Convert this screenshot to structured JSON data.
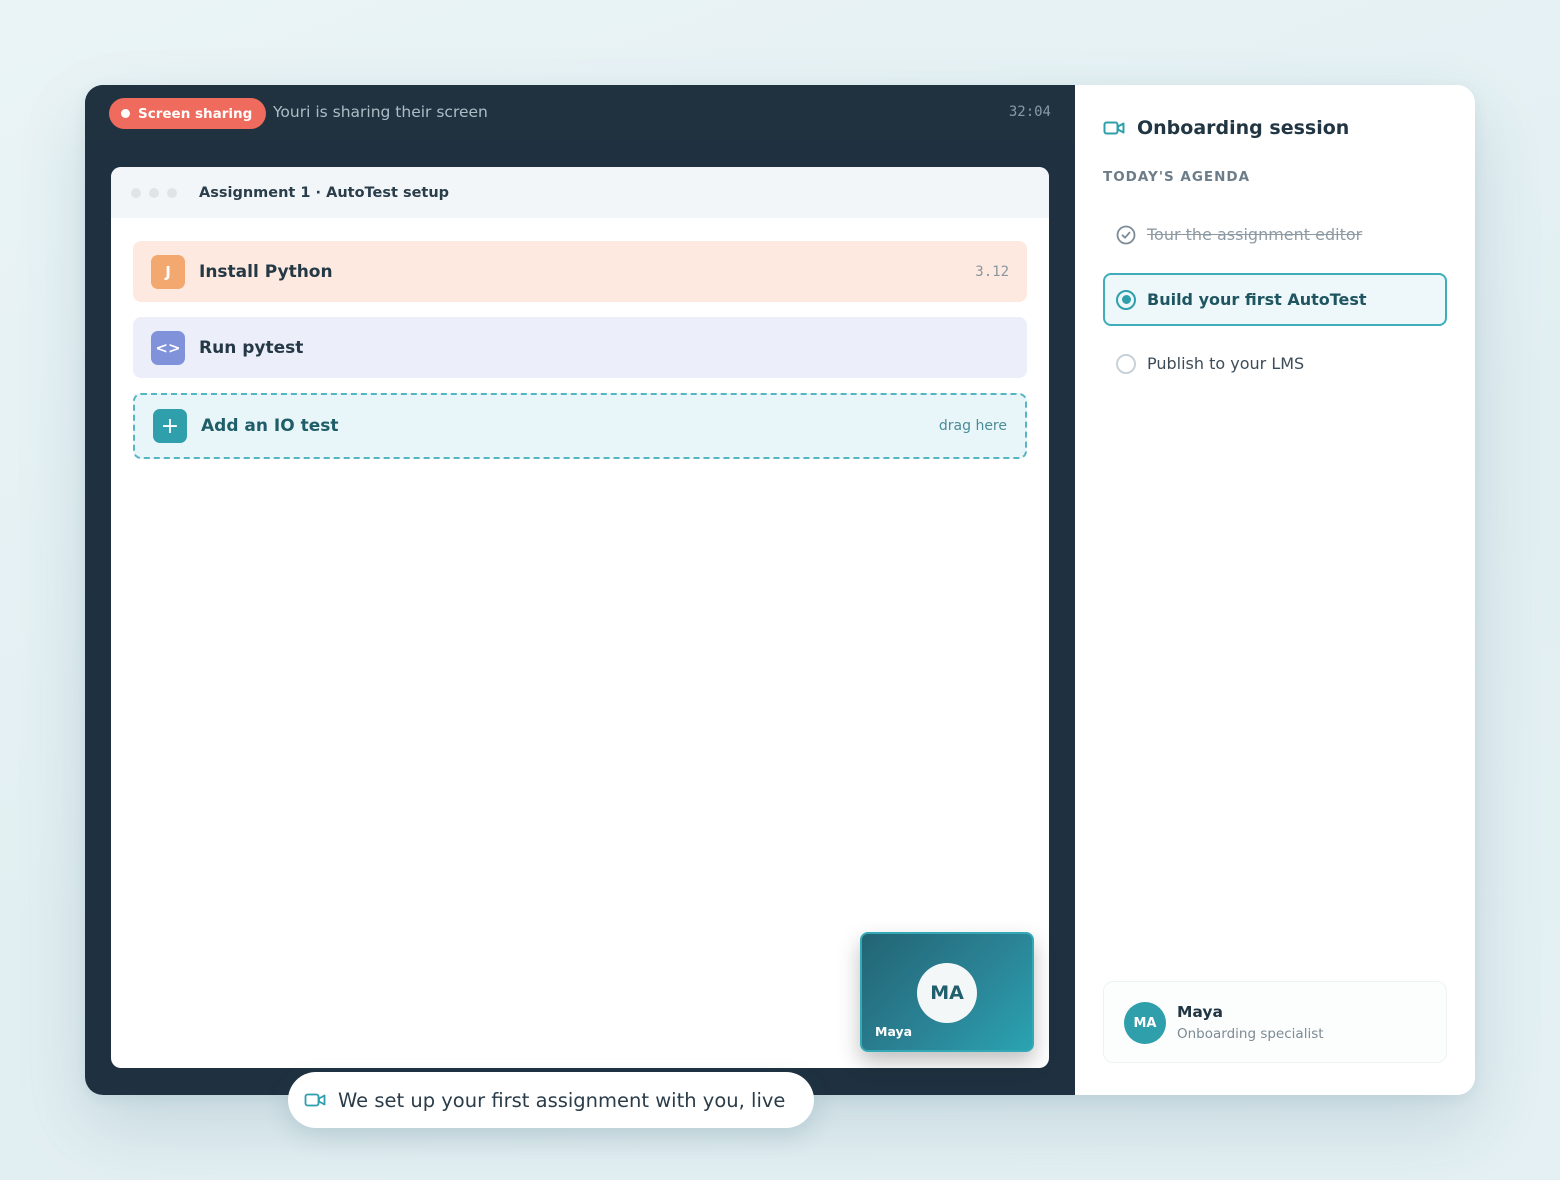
{
  "stage": {
    "badge": "Screen sharing",
    "share_message": "Youri is sharing their screen",
    "timer": "32:04"
  },
  "window": {
    "title": "Assignment 1 · AutoTest setup",
    "steps": [
      {
        "icon": "python-icon",
        "icon_glyph": "J",
        "label": "Install Python",
        "meta": "3.12",
        "color": "#f2a86e"
      },
      {
        "icon": "code-icon",
        "icon_glyph": "<>",
        "label": "Run pytest",
        "meta": "",
        "color": "#7f92da"
      },
      {
        "icon": "plus-icon",
        "icon_glyph": "+",
        "label": "Add an IO test",
        "meta": "drag here",
        "color": "#2e9fab"
      }
    ]
  },
  "pip": {
    "initials": "MA",
    "name": "Maya"
  },
  "sidebar": {
    "title": "Onboarding session",
    "title_icon": "video-camera-icon",
    "agenda_label": "TODAY'S AGENDA",
    "agenda": [
      {
        "label": "Tour the assignment editor",
        "state": "done"
      },
      {
        "label": "Build your first AutoTest",
        "state": "active"
      },
      {
        "label": "Publish to your LMS",
        "state": "todo"
      }
    ],
    "host": {
      "initials": "MA",
      "name": "Maya",
      "role": "Onboarding specialist"
    }
  },
  "caption": {
    "icon": "video-camera-icon",
    "text": "We set up your first assignment with you, live"
  },
  "colors": {
    "accent": "#2e9fab",
    "recording": "#ef6b5e",
    "stage_bg": "#1f3140"
  }
}
